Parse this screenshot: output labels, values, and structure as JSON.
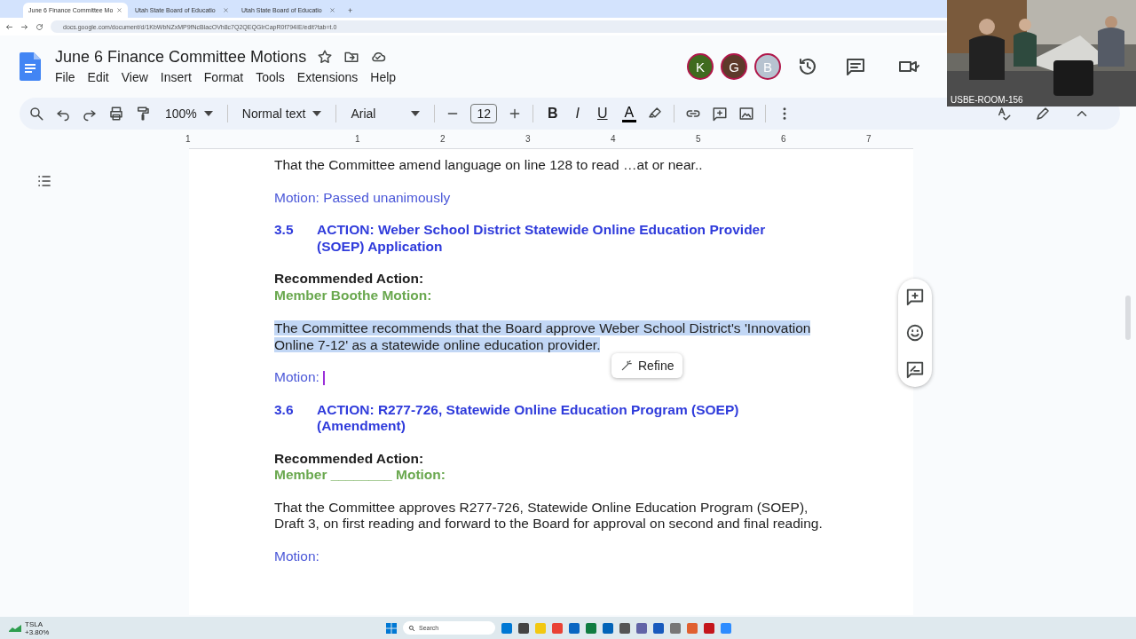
{
  "browser": {
    "tabs": [
      {
        "title": "June 6 Finance Committee Mo",
        "selected": true
      },
      {
        "title": "Utah State Board of Educatio",
        "selected": false
      },
      {
        "title": "Utah State Board of Educatio",
        "selected": false
      }
    ],
    "new_tab": "+",
    "url": "docs.google.com/document/d/1KbWbNZxMP9fNcBlacOVh8c7Q2QEQGIrCapR0f794IE/edit?tab=t.0"
  },
  "document": {
    "title": "June 6 Finance Committee Motions",
    "menu": [
      "File",
      "Edit",
      "View",
      "Insert",
      "Format",
      "Tools",
      "Extensions",
      "Help"
    ],
    "collaborators": [
      {
        "initial": "K",
        "color": "#3f6b1f"
      },
      {
        "initial": "G",
        "color": "#5d3a2a"
      },
      {
        "initial": "B",
        "color": "#b7c3d0"
      }
    ]
  },
  "toolbar": {
    "zoom": "100%",
    "style": "Normal text",
    "font": "Arial",
    "font_size": "12",
    "format_buttons": [
      "B",
      "I",
      "U"
    ],
    "text_color": "A"
  },
  "ruler": [
    "1",
    "1",
    "2",
    "3",
    "4",
    "5",
    "6",
    "7"
  ],
  "body": [
    {
      "kind": "body",
      "text": "That the Committee amend language on line 128 to read …at or near..",
      "selected": false
    },
    {
      "kind": "motion",
      "text": "Motion: Passed unanimously",
      "cursor": false
    },
    {
      "kind": "heading",
      "number": "3.5",
      "text": "ACTION: Weber School District Statewide Online Education Provider (SOEP) Application"
    },
    {
      "kind": "label",
      "text": "Recommended Action:"
    },
    {
      "kind": "mover",
      "text": "Member Boothe Motion:"
    },
    {
      "kind": "body",
      "text": "The Committee recommends that the Board approve Weber School District's 'Innovation Online 7-12' as a statewide online education provider.",
      "selected": true
    },
    {
      "kind": "motion",
      "text": "Motion:",
      "cursor": true
    },
    {
      "kind": "heading",
      "number": "3.6",
      "text": "ACTION: R277-726, Statewide Online Education Program (SOEP) (Amendment)"
    },
    {
      "kind": "label",
      "text": "Recommended Action:"
    },
    {
      "kind": "mover",
      "text": "Member ________ Motion:"
    },
    {
      "kind": "body",
      "text": "That the Committee approves R277-726, Statewide Online Education Program (SOEP), Draft 3, on first reading and forward to the Board for approval on second and final reading.",
      "selected": false
    },
    {
      "kind": "motion",
      "text": "Motion:",
      "cursor": false
    }
  ],
  "refine_button": "Refine",
  "video": {
    "label": "USBE-ROOM-156"
  },
  "taskbar": {
    "stock": "TSLA",
    "change": "+3.80%",
    "search": "Search"
  }
}
